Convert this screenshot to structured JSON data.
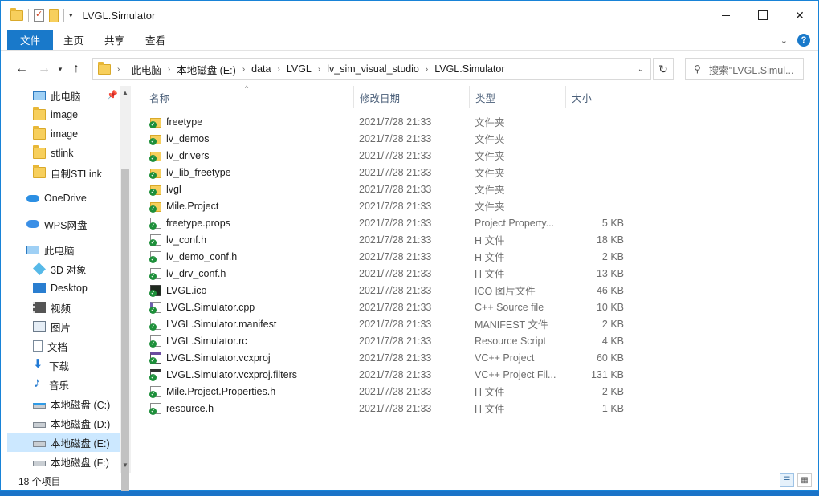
{
  "window": {
    "title": "LVGL.Simulator",
    "controls": {
      "minimize": "—",
      "maximize": "☐",
      "close": "✕"
    }
  },
  "ribbon": {
    "tabs": [
      "文件",
      "主页",
      "共享",
      "查看"
    ],
    "help": "?"
  },
  "nav": {
    "breadcrumb": [
      "此电脑",
      "本地磁盘 (E:)",
      "data",
      "LVGL",
      "lv_sim_visual_studio",
      "LVGL.Simulator"
    ],
    "search_placeholder": "搜索\"LVGL.Simul..."
  },
  "sidebar": {
    "items": [
      {
        "label": "此电脑",
        "icon": "pc-icon",
        "pinned": true
      },
      {
        "label": "image",
        "icon": "folder-icon"
      },
      {
        "label": "image",
        "icon": "folder-icon"
      },
      {
        "label": "stlink",
        "icon": "folder-icon"
      },
      {
        "label": "自制STLink",
        "icon": "folder-icon"
      },
      {
        "label": "OneDrive",
        "icon": "onedrive-icon"
      },
      {
        "label": "WPS网盘",
        "icon": "wps-cloud-icon"
      },
      {
        "label": "此电脑",
        "icon": "pc-icon"
      },
      {
        "label": "3D 对象",
        "icon": "3d-objects-icon"
      },
      {
        "label": "Desktop",
        "icon": "desktop-icon"
      },
      {
        "label": "视频",
        "icon": "video-icon"
      },
      {
        "label": "图片",
        "icon": "pictures-icon"
      },
      {
        "label": "文档",
        "icon": "documents-icon"
      },
      {
        "label": "下载",
        "icon": "downloads-icon"
      },
      {
        "label": "音乐",
        "icon": "music-icon"
      },
      {
        "label": "本地磁盘 (C:)",
        "icon": "system-drive-icon"
      },
      {
        "label": "本地磁盘 (D:)",
        "icon": "drive-icon"
      },
      {
        "label": "本地磁盘 (E:)",
        "icon": "drive-icon",
        "selected": true
      },
      {
        "label": "本地磁盘 (F:)",
        "icon": "drive-icon"
      }
    ]
  },
  "filelist": {
    "columns": {
      "name": "名称",
      "date": "修改日期",
      "type": "类型",
      "size": "大小"
    },
    "rows": [
      {
        "name": "freetype",
        "date": "2021/7/28 21:33",
        "type": "文件夹",
        "size": "",
        "icon": "folder"
      },
      {
        "name": "lv_demos",
        "date": "2021/7/28 21:33",
        "type": "文件夹",
        "size": "",
        "icon": "folder"
      },
      {
        "name": "lv_drivers",
        "date": "2021/7/28 21:33",
        "type": "文件夹",
        "size": "",
        "icon": "folder"
      },
      {
        "name": "lv_lib_freetype",
        "date": "2021/7/28 21:33",
        "type": "文件夹",
        "size": "",
        "icon": "folder"
      },
      {
        "name": "lvgl",
        "date": "2021/7/28 21:33",
        "type": "文件夹",
        "size": "",
        "icon": "folder"
      },
      {
        "name": "Mile.Project",
        "date": "2021/7/28 21:33",
        "type": "文件夹",
        "size": "",
        "icon": "folder"
      },
      {
        "name": "freetype.props",
        "date": "2021/7/28 21:33",
        "type": "Project Property...",
        "size": "5 KB",
        "icon": "file"
      },
      {
        "name": "lv_conf.h",
        "date": "2021/7/28 21:33",
        "type": "H 文件",
        "size": "18 KB",
        "icon": "file"
      },
      {
        "name": "lv_demo_conf.h",
        "date": "2021/7/28 21:33",
        "type": "H 文件",
        "size": "2 KB",
        "icon": "file"
      },
      {
        "name": "lv_drv_conf.h",
        "date": "2021/7/28 21:33",
        "type": "H 文件",
        "size": "13 KB",
        "icon": "file"
      },
      {
        "name": "LVGL.ico",
        "date": "2021/7/28 21:33",
        "type": "ICO 图片文件",
        "size": "46 KB",
        "icon": "ico"
      },
      {
        "name": "LVGL.Simulator.cpp",
        "date": "2021/7/28 21:33",
        "type": "C++ Source file",
        "size": "10 KB",
        "icon": "cpp"
      },
      {
        "name": "LVGL.Simulator.manifest",
        "date": "2021/7/28 21:33",
        "type": "MANIFEST 文件",
        "size": "2 KB",
        "icon": "file"
      },
      {
        "name": "LVGL.Simulator.rc",
        "date": "2021/7/28 21:33",
        "type": "Resource Script",
        "size": "4 KB",
        "icon": "file"
      },
      {
        "name": "LVGL.Simulator.vcxproj",
        "date": "2021/7/28 21:33",
        "type": "VC++ Project",
        "size": "60 KB",
        "icon": "proj"
      },
      {
        "name": "LVGL.Simulator.vcxproj.filters",
        "date": "2021/7/28 21:33",
        "type": "VC++ Project Fil...",
        "size": "131 KB",
        "icon": "filter"
      },
      {
        "name": "Mile.Project.Properties.h",
        "date": "2021/7/28 21:33",
        "type": "H 文件",
        "size": "2 KB",
        "icon": "file"
      },
      {
        "name": "resource.h",
        "date": "2021/7/28 21:33",
        "type": "H 文件",
        "size": "1 KB",
        "icon": "file"
      }
    ]
  },
  "status": {
    "item_count": "18 个项目"
  }
}
